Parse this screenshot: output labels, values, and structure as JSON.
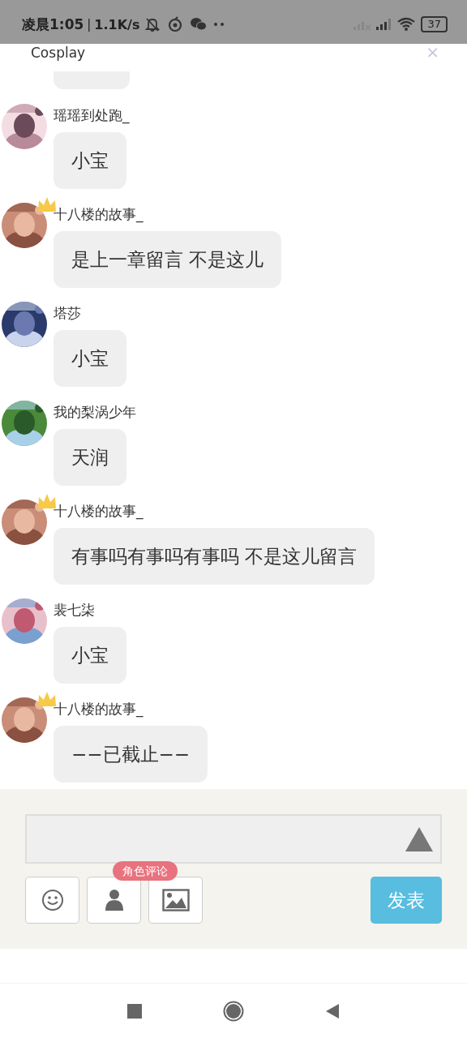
{
  "status_bar": {
    "time": "凌晨1:05",
    "separator": "|",
    "speed": "1.1K/s",
    "battery": "37"
  },
  "header": {
    "title": "Cosplay",
    "close": "×"
  },
  "messages": [
    {
      "name": "瑶瑶到处跑_",
      "text": "小宝",
      "crowned": false
    },
    {
      "name": "十八楼的故事_",
      "text": "是上一章留言 不是这儿",
      "crowned": true
    },
    {
      "name": "塔莎",
      "text": "小宝",
      "crowned": false
    },
    {
      "name": "我的梨涡少年",
      "text": "天润",
      "crowned": false
    },
    {
      "name": "十八楼的故事_",
      "text": "有事吗有事吗有事吗 不是这儿留言",
      "crowned": true
    },
    {
      "name": "裴七柒",
      "text": "小宝",
      "crowned": false
    },
    {
      "name": "十八楼的故事_",
      "text": "−−已截止−−",
      "crowned": true
    }
  ],
  "composer": {
    "tooltip": "角色评论",
    "send": "发表"
  }
}
